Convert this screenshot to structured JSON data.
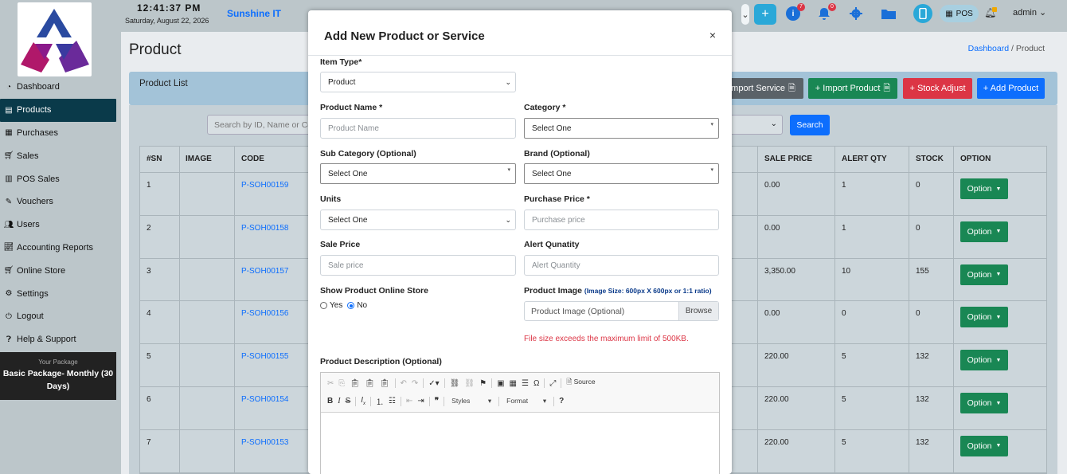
{
  "sidebar": {
    "items": [
      {
        "label": "Dashboard",
        "icon": "gauge-icon"
      },
      {
        "label": "Products",
        "icon": "box-icon"
      },
      {
        "label": "Purchases",
        "icon": "receipt-icon"
      },
      {
        "label": "Sales",
        "icon": "cart-icon"
      },
      {
        "label": "POS Sales",
        "icon": "cash-register-icon"
      },
      {
        "label": "Vouchers",
        "icon": "voucher-icon"
      },
      {
        "label": "Users",
        "icon": "users-icon"
      },
      {
        "label": "Accounting Reports",
        "icon": "chart-line-icon"
      },
      {
        "label": "Online Store",
        "icon": "store-cart-icon"
      },
      {
        "label": "Settings",
        "icon": "gears-icon"
      },
      {
        "label": "Logout",
        "icon": "logout-icon"
      },
      {
        "label": "Help & Support",
        "icon": "help-icon"
      }
    ],
    "active_index": 1,
    "package_caption": "Your Package",
    "package_name": "Basic Package- Monthly (30 Days)"
  },
  "topbar": {
    "clock": "12:41:37 PM",
    "date": "Saturday, August 22, 2026",
    "brand": "Sunshine IT",
    "badge_info": "7",
    "badge_bell": "0",
    "pos_label": "POS",
    "user": "admin"
  },
  "page": {
    "title": "Product",
    "breadcrumb_home": "Dashboard",
    "breadcrumb_sep": "/",
    "breadcrumb_current": "Product",
    "card_title": "Product List",
    "search_placeholder": "Search by ID, Name or Code",
    "search_button": "Search",
    "buttons": {
      "import_service": "Import Service",
      "import_product": "+ Import Product",
      "stock_adjust": "+ Stock Adjust",
      "add_product": "+ Add Product"
    }
  },
  "table": {
    "headers": [
      "#SN",
      "IMAGE",
      "CODE",
      "SALE PRICE",
      "ALERT QTY",
      "STOCK",
      "OPTION"
    ],
    "rows": [
      {
        "sn": "1",
        "code": "P-SOH00159",
        "sale_price": "0.00",
        "alert_qty": "1",
        "stock": "0"
      },
      {
        "sn": "2",
        "code": "P-SOH00158",
        "sale_price": "0.00",
        "alert_qty": "1",
        "stock": "0"
      },
      {
        "sn": "3",
        "code": "P-SOH00157",
        "sale_price": "3,350.00",
        "alert_qty": "10",
        "stock": "155"
      },
      {
        "sn": "4",
        "code": "P-SOH00156",
        "sale_price": "0.00",
        "alert_qty": "0",
        "stock": "0"
      },
      {
        "sn": "5",
        "code": "P-SOH00155",
        "sale_price": "220.00",
        "alert_qty": "5",
        "stock": "132"
      },
      {
        "sn": "6",
        "code": "P-SOH00154",
        "sale_price": "220.00",
        "alert_qty": "5",
        "stock": "132"
      },
      {
        "sn": "7",
        "code": "P-SOH00153",
        "sale_price": "220.00",
        "alert_qty": "5",
        "stock": "132"
      }
    ],
    "option_label": "Option"
  },
  "modal": {
    "title": "Add New Product or Service",
    "close": "×",
    "item_type_label": "Item Type*",
    "item_type_value": "Product",
    "product_name_label": "Product Name *",
    "product_name_placeholder": "Product Name",
    "category_label": "Category *",
    "category_value": "Select One",
    "sub_category_label": "Sub Category (Optional)",
    "sub_category_value": "Select One",
    "brand_label": "Brand (Optional)",
    "brand_value": "Select One",
    "units_label": "Units",
    "units_value": "Select One",
    "purchase_price_label": "Purchase Price *",
    "purchase_price_placeholder": "Purchase price",
    "sale_price_label": "Sale Price",
    "sale_price_placeholder": "Sale price",
    "alert_qty_label": "Alert Qunatity",
    "alert_qty_placeholder": "Alert Quantity",
    "online_store_label": "Show Product Online Store",
    "radio_yes": "Yes",
    "radio_no": "No",
    "radio_selected": "No",
    "image_label": "Product Image",
    "image_hint": "(Image Size: 600px X 600px or 1:1 ratio)",
    "image_placeholder": "Product Image (Optional)",
    "browse": "Browse",
    "error": "File size exceeds the maximum limit of 500KB.",
    "description_label": "Product Description (Optional)",
    "editor": {
      "source": "Source",
      "styles": "Styles",
      "format": "Format",
      "help": "?"
    }
  },
  "colors": {
    "primary": "#0d6efd",
    "success": "#198754",
    "danger": "#dc3545",
    "sidebar_active": "#0a3a4a"
  }
}
